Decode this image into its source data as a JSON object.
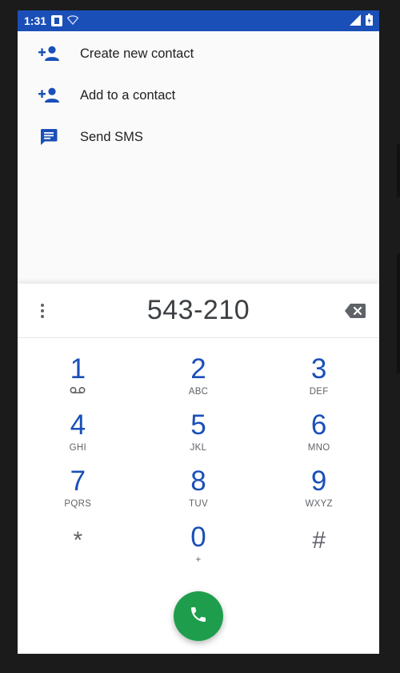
{
  "status_bar": {
    "time": "1:31",
    "icons": [
      "sim-icon",
      "wifi-icon",
      "signal-icon",
      "battery-icon"
    ]
  },
  "suggestions": [
    {
      "label": "Create new contact",
      "icon": "person-add-icon"
    },
    {
      "label": "Add to a contact",
      "icon": "person-add-icon"
    },
    {
      "label": "Send SMS",
      "icon": "message-icon"
    }
  ],
  "dialpad": {
    "digits": "543-210",
    "keys": [
      {
        "digit": "1",
        "letters": ""
      },
      {
        "digit": "2",
        "letters": "ABC"
      },
      {
        "digit": "3",
        "letters": "DEF"
      },
      {
        "digit": "4",
        "letters": "GHI"
      },
      {
        "digit": "5",
        "letters": "JKL"
      },
      {
        "digit": "6",
        "letters": "MNO"
      },
      {
        "digit": "7",
        "letters": "PQRS"
      },
      {
        "digit": "8",
        "letters": "TUV"
      },
      {
        "digit": "9",
        "letters": "WXYZ"
      },
      {
        "digit": "*",
        "letters": ""
      },
      {
        "digit": "0",
        "letters": "+"
      },
      {
        "digit": "#",
        "letters": ""
      }
    ]
  },
  "colors": {
    "accent": "#1a4fb8",
    "call_button": "#1e9e4c",
    "text_primary": "#202124",
    "text_secondary": "#5f6368"
  }
}
